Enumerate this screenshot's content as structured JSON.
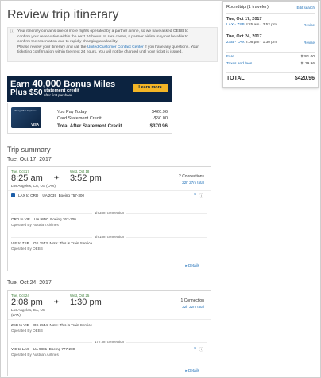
{
  "page": {
    "title": "Review trip itinerary"
  },
  "notice": {
    "line1": "Your itinerary contains one or more flights operated by a partner airline, so we have asked OEBB to",
    "line2": "confirm your reservation within the next 24 hours. In rare cases, a partner airline may not be able to",
    "line3": "confirm the reservation due to rapidly changing availability.",
    "line4_pre": "Please review your itinerary and call the",
    "link": "United Customer Contact Center",
    "line4_post": "if you have any questions. Your",
    "line5": "ticketing confirmation within the next 24 hours. You will not be charged until your ticket is issued."
  },
  "summary": {
    "header": "Roundtrip (1 traveler)",
    "edit": "Edit search",
    "outbound": {
      "date": "Tue, Oct 17, 2017",
      "code": "LAX - ZSB",
      "times": "8:25 am - 3:52 pm",
      "revise": "Revise"
    },
    "inbound": {
      "date": "Tue, Oct 24, 2017",
      "code": "ZSB - LAX",
      "times": "2:08 pm - 1:30 pm",
      "revise": "Revise"
    },
    "fare_label": "Fare",
    "fare": "$281.00",
    "taxes_label": "Taxes and fees",
    "taxes": "$139.96",
    "total_label": "TOTAL",
    "total": "$420.96"
  },
  "promo": {
    "earn": "Earn",
    "miles": "40,000",
    "bonus": "Bonus Miles",
    "plus": "Plus",
    "credit_amount": "$50",
    "credit_line1": "statement credit",
    "credit_line2": "after first purchase",
    "learn": "Learn more",
    "card_line1": "MileagePlus Explorer",
    "card_line2": "VISA"
  },
  "payment": {
    "pay_today_label": "You Pay Today",
    "pay_today": "$420.96",
    "credit_label": "Card Statement Credit",
    "credit": "-$50.00",
    "total_label": "Total After Statement Credit",
    "total": "$370.96"
  },
  "trip": {
    "summary_title": "Trip summary",
    "outbound": {
      "day_title": "Tue, Oct 17, 2017",
      "dep_date": "Tue, Oct 17",
      "dep_time": "8:25 am",
      "dep_city": "Los Angeles, CA, US (LAX)",
      "arr_date": "Wed, Oct 18",
      "arr_time": "3:52 pm",
      "connections": "2 Connections",
      "duration": "22h 27m total",
      "legs": [
        {
          "route": "LAX to ORD",
          "flight": "UA 2039",
          "aircraft": "Boeing 757-300",
          "operator": ""
        },
        {
          "route": "ORD to VIE",
          "flight": "UA 9850",
          "aircraft": "Boeing 767-300",
          "operator": "Operated By Austrian Airlines"
        },
        {
          "route": "VIE to ZSB",
          "flight": "OS 3543",
          "aircraft": "Note: This is Train Service",
          "operator": "Operated By OEBB"
        }
      ],
      "layovers": [
        "1h 38m connection",
        "4h 18m connection"
      ],
      "details": "Details"
    },
    "inbound": {
      "day_title": "Tue, Oct 24, 2017",
      "dep_date": "Tue, Oct 24",
      "dep_time": "2:08 pm",
      "dep_city": "Los Angeles, CA, US",
      "dep_city2": "(LAX)",
      "arr_date": "Wed, Oct 25",
      "arr_time": "1:30 pm",
      "connections": "1 Connection",
      "duration": "32h 22m total",
      "legs": [
        {
          "route": "ZSB to VIE",
          "flight": "OS 3544",
          "aircraft": "Note: This is Train Service",
          "operator": "Operated By OEBB"
        },
        {
          "route": "VIE to LAX",
          "flight": "UA 9881",
          "aircraft": "Boeing 777-200",
          "operator": "Operated By Austrian Airlines"
        }
      ],
      "layovers": [
        "17h 3m connection"
      ],
      "details": "Details"
    }
  }
}
